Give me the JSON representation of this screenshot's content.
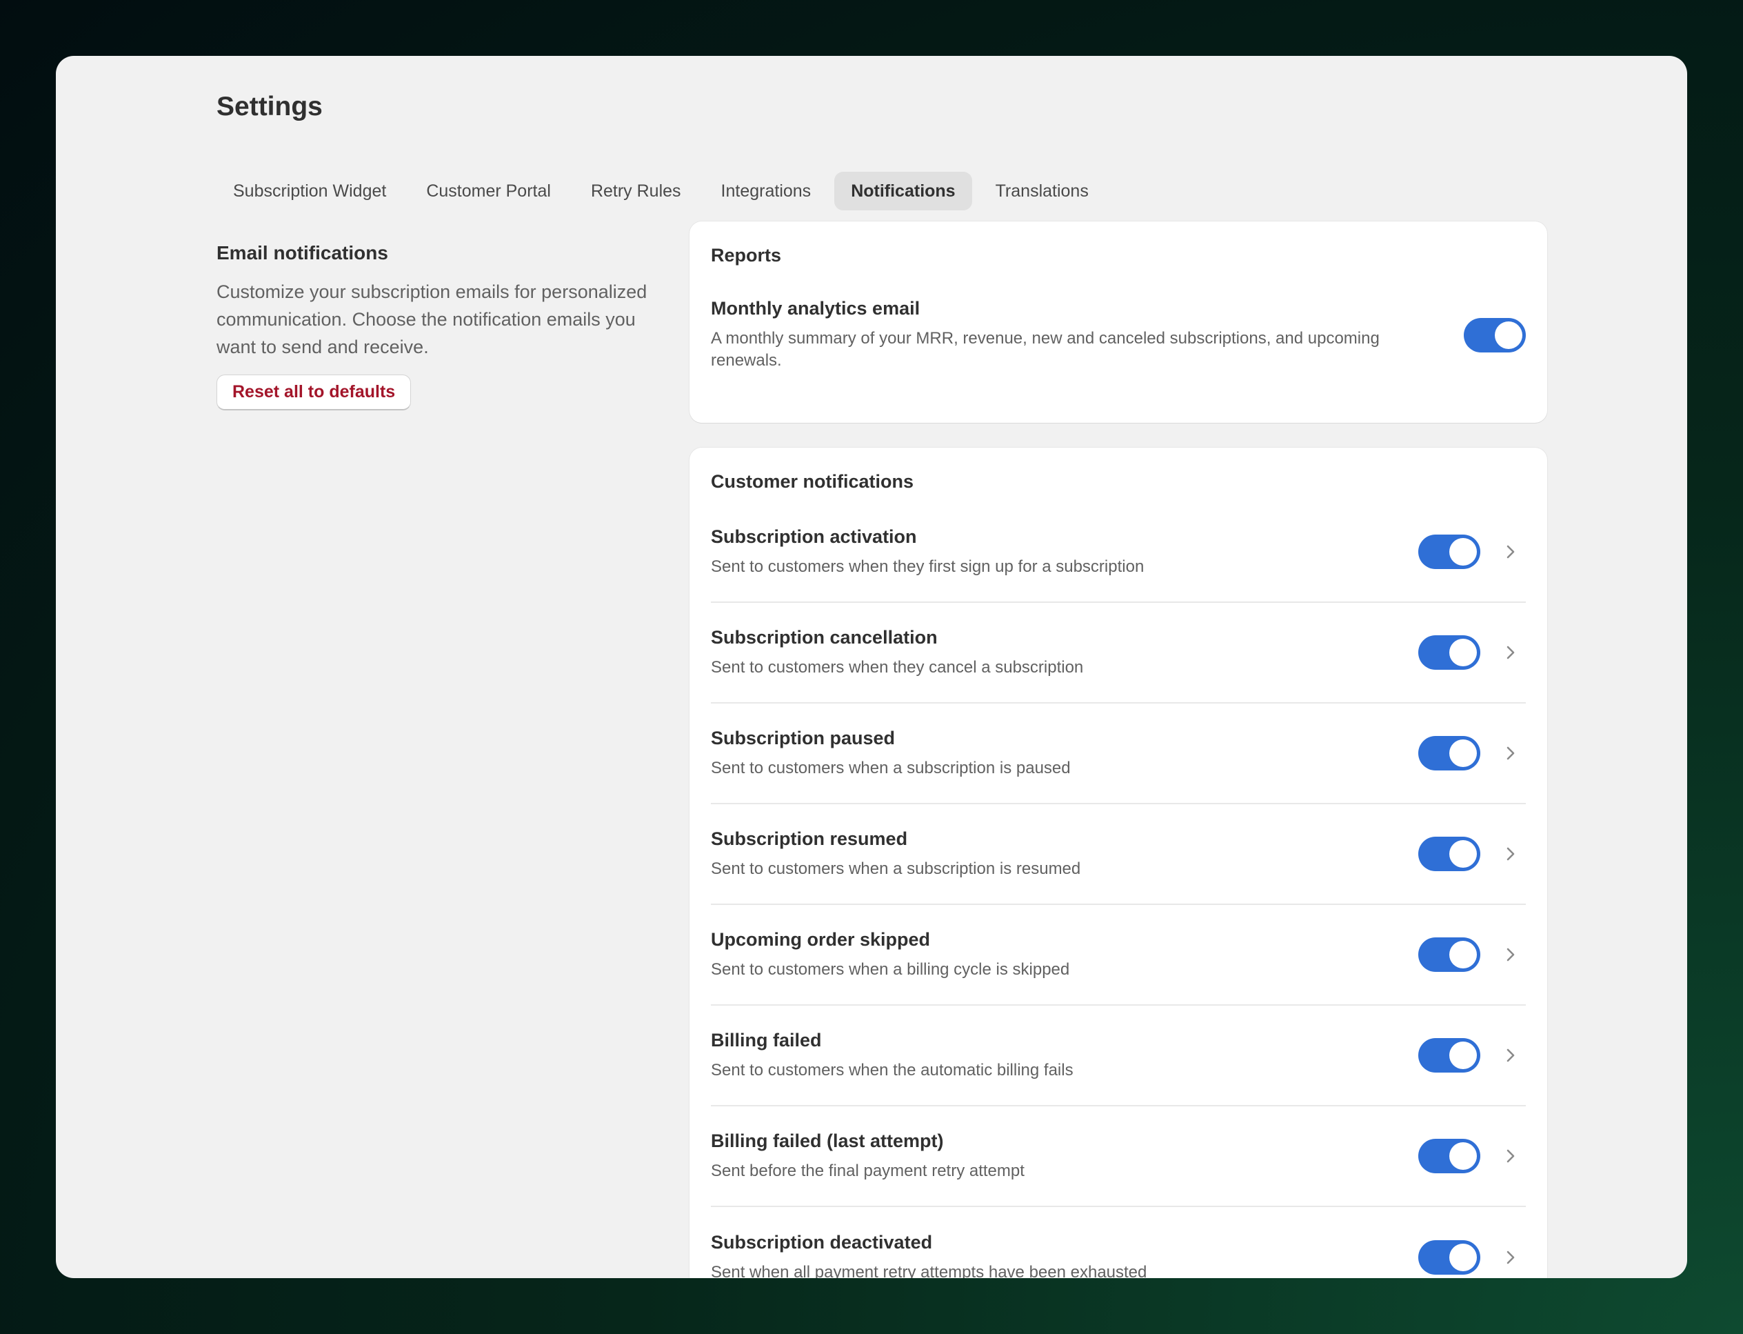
{
  "page": {
    "title": "Settings"
  },
  "tabs": [
    {
      "label": "Subscription Widget",
      "active": false
    },
    {
      "label": "Customer Portal",
      "active": false
    },
    {
      "label": "Retry Rules",
      "active": false
    },
    {
      "label": "Integrations",
      "active": false
    },
    {
      "label": "Notifications",
      "active": true
    },
    {
      "label": "Translations",
      "active": false
    }
  ],
  "email_notifications": {
    "title": "Email notifications",
    "description": "Customize your subscription emails for personalized communication. Choose the notification emails you want to send and receive.",
    "reset_label": "Reset all to defaults"
  },
  "reports": {
    "title": "Reports",
    "items": [
      {
        "title": "Monthly analytics email",
        "description": "A monthly summary of your MRR, revenue, new and canceled subscriptions, and upcoming renewals.",
        "enabled": true
      }
    ]
  },
  "customer_notifications": {
    "title": "Customer notifications",
    "items": [
      {
        "title": "Subscription activation",
        "description": "Sent to customers when they first sign up for a subscription",
        "enabled": true
      },
      {
        "title": "Subscription cancellation",
        "description": "Sent to customers when they cancel a subscription",
        "enabled": true
      },
      {
        "title": "Subscription paused",
        "description": "Sent to customers when a subscription is paused",
        "enabled": true
      },
      {
        "title": "Subscription resumed",
        "description": "Sent to customers when a subscription is resumed",
        "enabled": true
      },
      {
        "title": "Upcoming order skipped",
        "description": "Sent to customers when a billing cycle is skipped",
        "enabled": true
      },
      {
        "title": "Billing failed",
        "description": "Sent to customers when the automatic billing fails",
        "enabled": true
      },
      {
        "title": "Billing failed (last attempt)",
        "description": "Sent before the final payment retry attempt",
        "enabled": true
      },
      {
        "title": "Subscription deactivated",
        "description": "Sent when all payment retry attempts have been exhausted",
        "enabled": true
      }
    ]
  },
  "colors": {
    "toggle_on": "#2f6fd6",
    "reset_text": "#a3152a",
    "active_tab_bg": "#e0e0e0"
  },
  "icons": {
    "row_action": "chevron-right-icon"
  }
}
